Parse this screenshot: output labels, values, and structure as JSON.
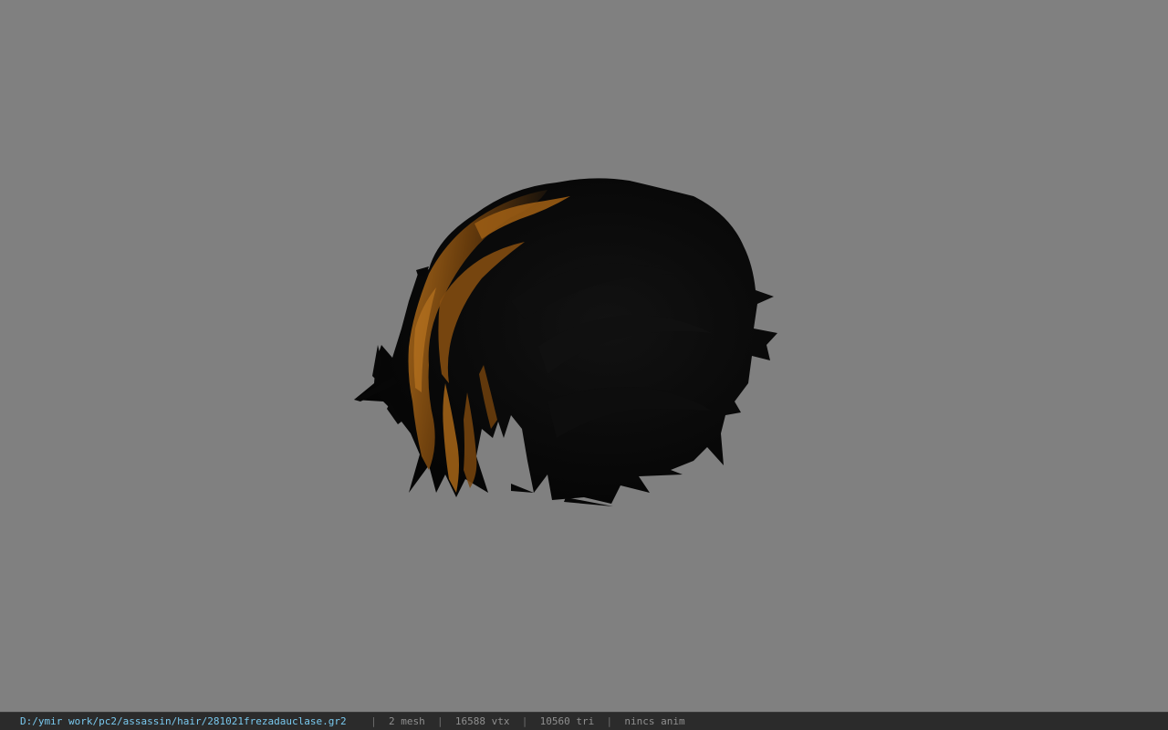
{
  "viewer": {
    "background_color": "#808080",
    "model": {
      "hair_highlight_color": "#a8661a",
      "hair_shadow_color": "#0b0b0b"
    }
  },
  "status_bar": {
    "file_path": "D:/ymir work/pc2/assassin/hair/281021frezadauclase.gr2",
    "separator": "|",
    "mesh_count": "2 mesh",
    "vertex_count": "16588 vtx",
    "triangle_count": "10560 tri",
    "animation_status": "nincs anim",
    "path_color": "#79c9ef",
    "text_color": "#8f8f8f"
  }
}
